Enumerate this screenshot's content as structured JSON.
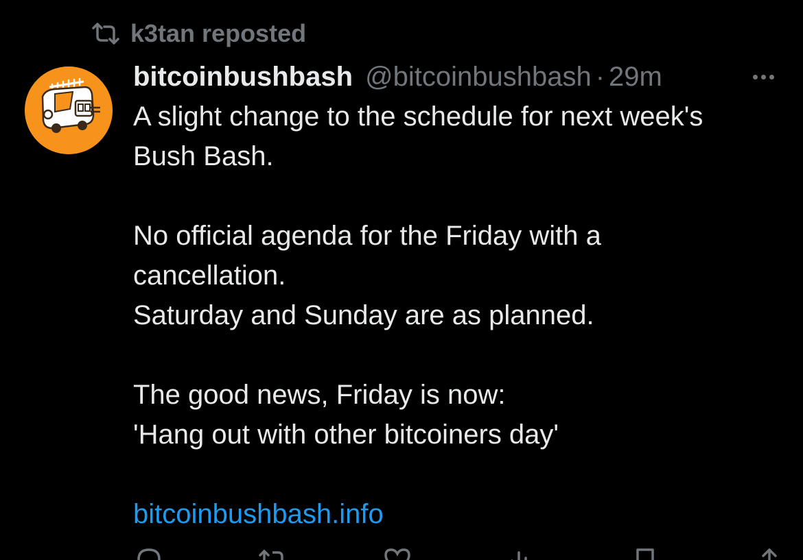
{
  "repost": {
    "icon": "repost-icon",
    "label": "k3tan reposted"
  },
  "author": {
    "display_name": "bitcoinbushbash",
    "handle": "@bitcoinbushbash",
    "separator": "·",
    "time": "29m",
    "avatar_color": "#f7931a"
  },
  "tweet": {
    "lines": [
      "A slight change to the schedule for next week's",
      "Bush Bash.",
      "",
      "No official agenda for the Friday with a",
      "cancellation.",
      "Saturday and Sunday are as planned.",
      "",
      "The good news, Friday is now:",
      "'Hang out with other bitcoiners day'",
      ""
    ],
    "link": "bitcoinbushbash.info"
  },
  "actions": [
    {
      "icon": "reply-icon"
    },
    {
      "icon": "repost-icon"
    },
    {
      "icon": "like-icon"
    },
    {
      "icon": "views-icon"
    },
    {
      "icon": "bookmark-icon"
    },
    {
      "icon": "share-icon"
    }
  ],
  "colors": {
    "background": "#000000",
    "text": "#e7e9ea",
    "muted": "#71767b",
    "link": "#1d9bf0"
  }
}
